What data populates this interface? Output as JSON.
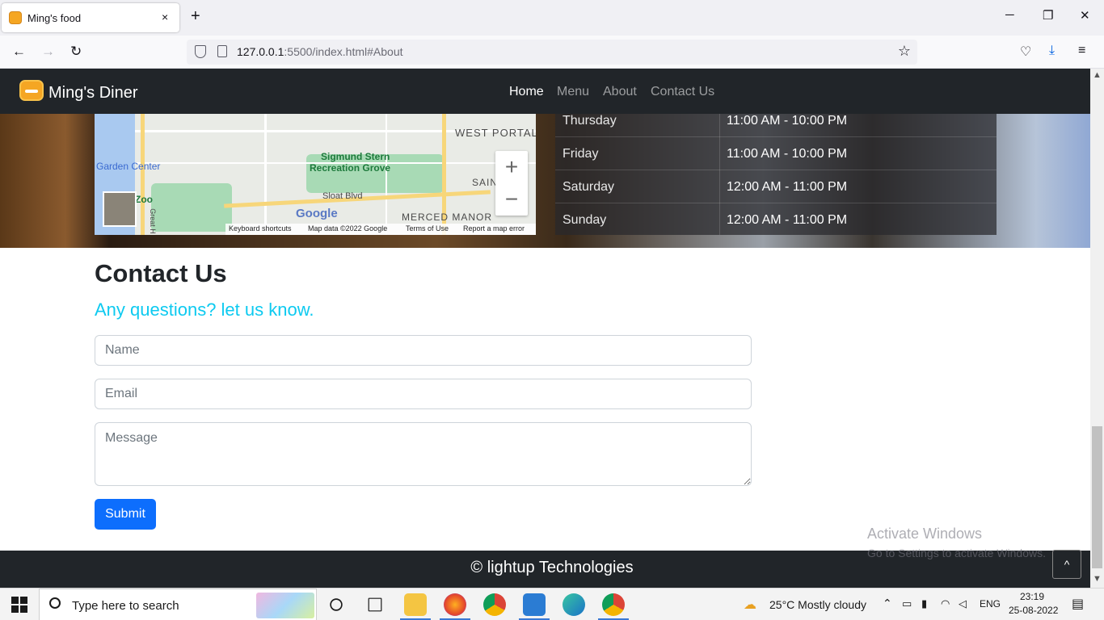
{
  "browser": {
    "tab_title": "Ming's food",
    "close_tab": "×",
    "new_tab": "+",
    "window_controls": {
      "minimize": "─",
      "restore": "❐",
      "close": "✕"
    },
    "back": "←",
    "forward": "→",
    "reload": "↻",
    "url_host": "127.0.0.1",
    "url_rest": ":5500/index.html#About",
    "bookmark_star": "☆",
    "pocket": "♡",
    "download": "⤓",
    "menu": "≡"
  },
  "site": {
    "brand": "Ming's Diner",
    "nav": [
      "Home",
      "Menu",
      "About",
      "Contact Us"
    ],
    "map": {
      "labels": {
        "west_portal": "WEST PORTAL",
        "sigmund_1": "Sigmund Stern",
        "sigmund_2": "Recreation Grove",
        "garden": "Garden Center",
        "zoo": "Zoo",
        "sloat": "Sloat Blvd",
        "merced": "MERCED MANOR",
        "sain": "SAIN",
        "great_h": "Great H"
      },
      "zoom_in": "+",
      "zoom_out": "−",
      "google": "Google",
      "footer": [
        "Keyboard shortcuts",
        "Map data ©2022 Google",
        "Terms of Use",
        "Report a map error"
      ]
    },
    "hours": [
      {
        "day": "Thursday",
        "time": "11:00 AM - 10:00 PM"
      },
      {
        "day": "Friday",
        "time": "11:00 AM - 10:00 PM"
      },
      {
        "day": "Saturday",
        "time": "12:00 AM - 11:00 PM"
      },
      {
        "day": "Sunday",
        "time": "12:00 AM - 11:00 PM"
      }
    ],
    "contact": {
      "title": "Contact Us",
      "subtitle": "Any questions? let us know.",
      "name_placeholder": "Name",
      "email_placeholder": "Email",
      "message_placeholder": "Message",
      "submit": "Submit"
    },
    "footer": "© lightup Technologies",
    "back_to_top": "^"
  },
  "watermark": {
    "line1": "Activate Windows",
    "line2": "Go to Settings to activate Windows."
  },
  "taskbar": {
    "search_placeholder": "Type here to search",
    "weather": "25°C  Mostly cloudy",
    "lang": "ENG",
    "time": "23:19",
    "date": "25-08-2022"
  }
}
